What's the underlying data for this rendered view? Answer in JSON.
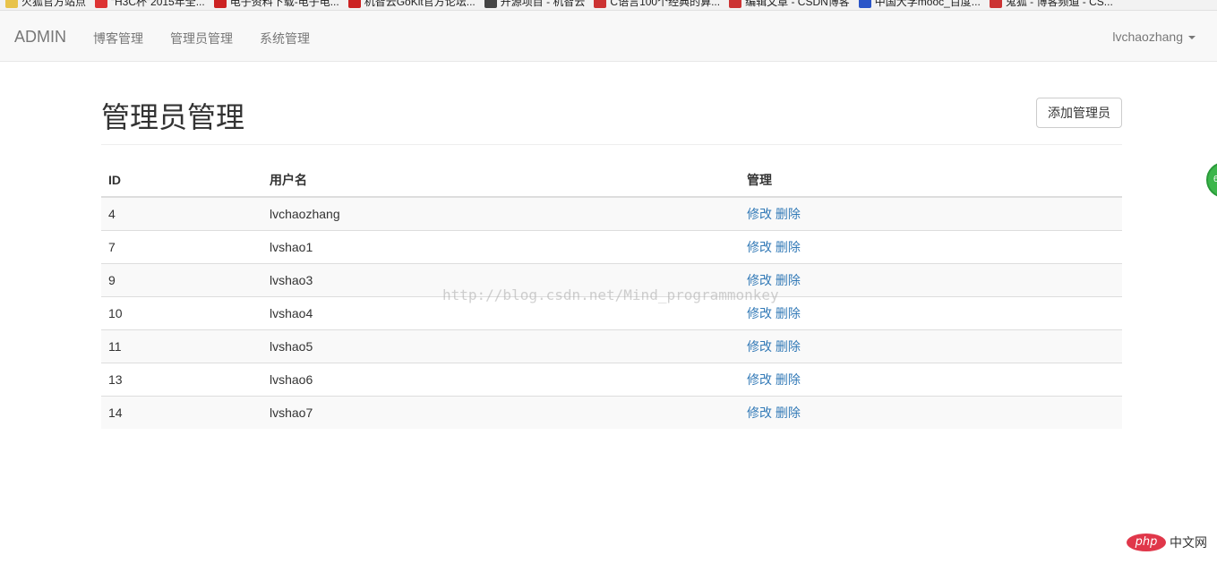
{
  "bookmarks": [
    {
      "label": "火狐官方站点",
      "icon": "folder-icon",
      "color": "#e8c34a"
    },
    {
      "label": "“H3C杯”2015年全...",
      "icon": "h3c-icon",
      "color": "#d33"
    },
    {
      "label": "电子资料下载-电子电...",
      "icon": "site-icon",
      "color": "#c22"
    },
    {
      "label": "机智云GoKit官方论坛...",
      "icon": "site-icon",
      "color": "#c22"
    },
    {
      "label": "开源项目 - 机智云",
      "icon": "site-icon",
      "color": "#444"
    },
    {
      "label": "C语言100个经典的算...",
      "icon": "csdn-icon",
      "color": "#c33"
    },
    {
      "label": "编辑文章 - CSDN博客",
      "icon": "csdn-icon",
      "color": "#c33"
    },
    {
      "label": "中国大学mooc_百度...",
      "icon": "baidu-icon",
      "color": "#2a55c8"
    },
    {
      "label": "鬼狐 - 博客频道 - CS...",
      "icon": "csdn-icon",
      "color": "#c33"
    }
  ],
  "navbar": {
    "brand": "ADMIN",
    "links": [
      "博客管理",
      "管理员管理",
      "系统管理"
    ],
    "user": "lvchaozhang"
  },
  "page": {
    "title": "管理员管理",
    "add_button": "添加管理员"
  },
  "table": {
    "headers": [
      "ID",
      "用户名",
      "管理"
    ],
    "rows": [
      {
        "id": "4",
        "username": "lvchaozhang"
      },
      {
        "id": "7",
        "username": "lvshao1"
      },
      {
        "id": "9",
        "username": "lvshao3"
      },
      {
        "id": "10",
        "username": "lvshao4"
      },
      {
        "id": "11",
        "username": "lvshao5"
      },
      {
        "id": "13",
        "username": "lvshao6"
      },
      {
        "id": "14",
        "username": "lvshao7"
      }
    ],
    "edit_label": "修改",
    "delete_label": "删除"
  },
  "watermark": "http://blog.csdn.net/Mind_programmonkey",
  "php_logo": {
    "badge": "php",
    "text": "中文网"
  },
  "colors": {
    "link": "#337ab7",
    "navbar_bg": "#f8f8f8",
    "widget": "#3cb64b",
    "php_badge": "#e0374a"
  }
}
